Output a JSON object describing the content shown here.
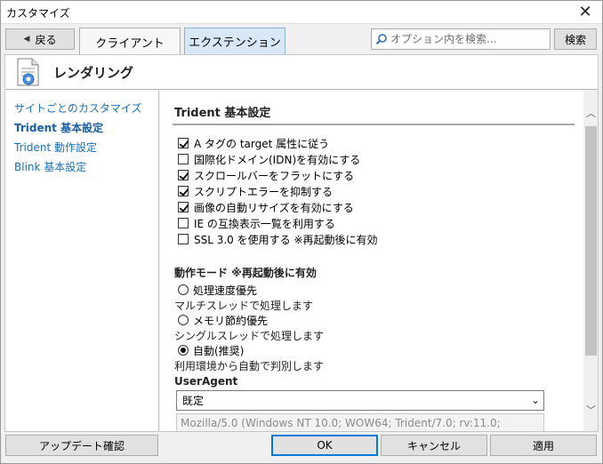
{
  "window": {
    "title": "カスタマイズ",
    "close_glyph": "✕"
  },
  "toolbar": {
    "back_label": "戻る",
    "tabs": [
      {
        "label": "クライアント"
      },
      {
        "label": "エクステンション"
      }
    ],
    "search": {
      "placeholder": "オプション内を検索...",
      "value": ""
    },
    "search_button": "検索"
  },
  "header": {
    "title": "レンダリング"
  },
  "sidebar": {
    "items": [
      {
        "label": "サイトごとのカスタマイズ",
        "active": false
      },
      {
        "label": "Trident 基本設定",
        "active": true
      },
      {
        "label": "Trident 動作設定",
        "active": false
      },
      {
        "label": "Blink 基本設定",
        "active": false
      }
    ]
  },
  "main": {
    "section_title": "Trident 基本設定",
    "options": [
      {
        "label": "A タグの target 属性に従う",
        "checked": true
      },
      {
        "label": "国際化ドメイン(IDN)を有効にする",
        "checked": false
      },
      {
        "label": "スクロールバーをフラットにする",
        "checked": true
      },
      {
        "label": "スクリプトエラーを抑制する",
        "checked": true
      },
      {
        "label": "画像の自動リサイズを有効にする",
        "checked": true
      },
      {
        "label": "IE の互換表示一覧を利用する",
        "checked": false
      },
      {
        "label": "SSL 3.0 を使用する ※再起動後に有効",
        "checked": false
      }
    ],
    "mode_title": "動作モード ※再起動後に有効",
    "modes": [
      {
        "label": "処理速度優先",
        "desc": "マルチスレッドで処理します",
        "selected": false
      },
      {
        "label": "メモリ節約優先",
        "desc": "シングルスレッドで処理します",
        "selected": false
      },
      {
        "label": "自動(推奨)",
        "desc": "利用環境から自動で判別します",
        "selected": true
      }
    ],
    "ua_label": "UserAgent",
    "ua_select_value": "既定",
    "ua_string": "Mozilla/5.0 (Windows NT 10.0; WOW64; Trident/7.0; rv:11.0;"
  },
  "footer": {
    "update_label": "アップデート確認",
    "ok_label": "OK",
    "cancel_label": "キャンセル",
    "apply_label": "適用"
  },
  "colors": {
    "link": "#1a6fb5",
    "active_tab": "#d9e8f6",
    "ok_border": "#0078d7"
  }
}
